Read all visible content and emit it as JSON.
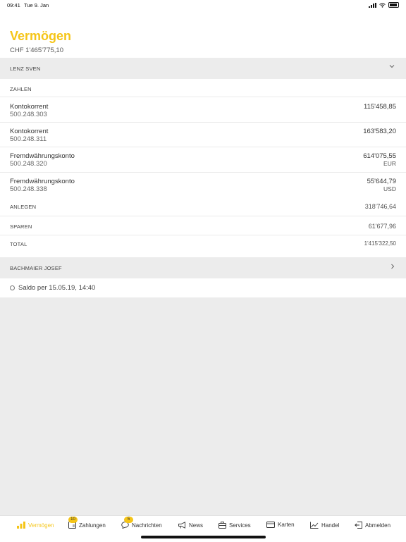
{
  "status_bar": {
    "time": "09:41",
    "date": "Tue 9. Jan"
  },
  "header": {
    "title": "Vermögen",
    "total": "CHF 1'465'775,10"
  },
  "persons": [
    {
      "name": "LENZ SVEN",
      "sections": {
        "zahlen_label": "ZAHLEN",
        "accounts": [
          {
            "name": "Kontokorrent",
            "number": "500.248.303",
            "amount": "115'458,85",
            "currency": ""
          },
          {
            "name": "Kontokorrent",
            "number": "500.248.311",
            "amount": "163'583,20",
            "currency": ""
          },
          {
            "name": "Fremdwährungskonto",
            "number": "500.248.320",
            "amount": "614'075,55",
            "currency": "EUR"
          },
          {
            "name": "Fremdwährungskonto",
            "number": "500.248.338",
            "amount": "55'644,79",
            "currency": "USD"
          }
        ],
        "anlegen": {
          "label": "ANLEGEN",
          "amount": "318'746,64"
        },
        "sparen": {
          "label": "SPAREN",
          "amount": "61'677,96"
        },
        "total": {
          "label": "TOTAL",
          "amount": "1'415'322,50"
        }
      }
    },
    {
      "name": "BACHMAIER JOSEF"
    }
  ],
  "saldo": "Saldo per 15.05.19, 14:40",
  "tabs": [
    {
      "label": "Vermögen",
      "active": true
    },
    {
      "label": "Zahlungen",
      "badge": "10"
    },
    {
      "label": "Nachrichten",
      "badge": "5"
    },
    {
      "label": "News"
    },
    {
      "label": "Services"
    },
    {
      "label": "Karten"
    },
    {
      "label": "Handel"
    },
    {
      "label": "Abmelden"
    }
  ],
  "colors": {
    "accent": "#f5c518",
    "background": "#ececec"
  }
}
